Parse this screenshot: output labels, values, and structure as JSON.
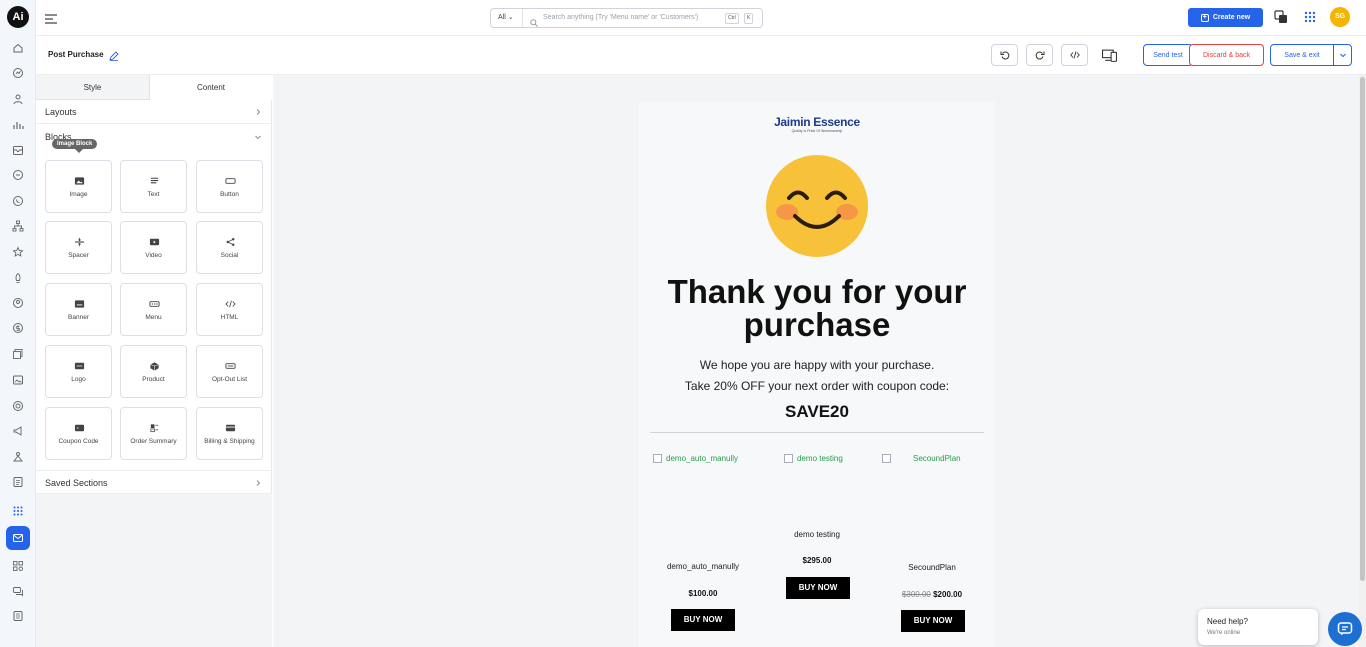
{
  "app": {
    "logo_text": "Ai"
  },
  "rail": {
    "items": [
      "home-icon",
      "chart-icon",
      "users-icon",
      "bar-chart-icon",
      "inbox-icon",
      "chat-icon",
      "whatsapp-icon",
      "hierarchy-icon",
      "star-icon",
      "rocket-icon",
      "contacts-icon",
      "dollar-icon",
      "pages-icon",
      "media-icon",
      "support-icon",
      "megaphone-icon",
      "org-icon",
      "list-icon",
      "apps-icon",
      "email-icon",
      "components-icon",
      "messages-icon",
      "settings-icon"
    ],
    "active_index": 19
  },
  "topbar": {
    "search_scope": "All",
    "search_placeholder": "Search anything (Try 'Menu name' or 'Customers')",
    "kbd_ctrl": "Ctrl",
    "kbd_k": "K",
    "create_label": "Create new",
    "avatar_initials": "SG"
  },
  "subheader": {
    "title": "Post Purchase",
    "send_test": "Send test",
    "discard": "Discard & back",
    "save_exit": "Save & exit"
  },
  "panel": {
    "tabs": [
      "Style",
      "Content"
    ],
    "active_tab": "Content",
    "layouts_label": "Layouts",
    "blocks_label": "Blocks",
    "tooltip": "Image Block",
    "blocks": [
      {
        "label": "Image",
        "icon": "image-icon"
      },
      {
        "label": "Text",
        "icon": "text-icon"
      },
      {
        "label": "Button",
        "icon": "button-icon"
      },
      {
        "label": "Spacer",
        "icon": "spacer-icon"
      },
      {
        "label": "Video",
        "icon": "video-icon"
      },
      {
        "label": "Social",
        "icon": "share-icon"
      },
      {
        "label": "Banner",
        "icon": "banner-icon"
      },
      {
        "label": "Menu",
        "icon": "menu-block-icon"
      },
      {
        "label": "HTML",
        "icon": "code-icon"
      },
      {
        "label": "Logo",
        "icon": "logo-block-icon"
      },
      {
        "label": "Product",
        "icon": "product-icon"
      },
      {
        "label": "Opt-Out List",
        "icon": "optout-icon"
      },
      {
        "label": "Coupon Code",
        "icon": "coupon-icon"
      },
      {
        "label": "Order Summary",
        "icon": "order-summary-icon"
      },
      {
        "label": "Billing & Shipping",
        "icon": "billing-icon"
      }
    ],
    "saved_sections_label": "Saved Sections"
  },
  "email": {
    "brand_name": "Jaimin Essence",
    "brand_tagline": "Quality Is Pride Of Workmanship",
    "headline": "Thank you for your purchase",
    "line1": "We hope you are happy with your purchase.",
    "line2": "Take 20% OFF your next order with coupon code:",
    "coupon_code": "SAVE20",
    "products": [
      {
        "img_alt": "demo_auto_manully",
        "name": "demo_auto_manully",
        "price": "$100.00",
        "old_price": "",
        "buy": "BUY NOW"
      },
      {
        "img_alt": "demo testing",
        "name": "demo testing",
        "price": "$295.00",
        "old_price": "",
        "buy": "BUY NOW"
      },
      {
        "img_alt": "SecoundPlan",
        "name": "SecoundPlan",
        "price": "$200.00",
        "old_price": "$300.00",
        "buy": "BUY NOW"
      }
    ]
  },
  "help": {
    "title": "Need help?",
    "status": "We're online"
  },
  "colors": {
    "primary": "#2563eb",
    "danger": "#e53e3e",
    "avatar": "#f5b400",
    "link_green": "#2a9d4a"
  }
}
